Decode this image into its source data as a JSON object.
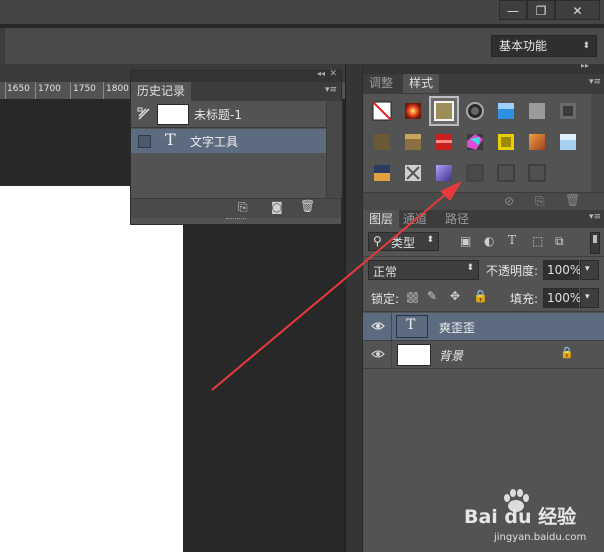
{
  "window": {
    "minimize": "—",
    "restore": "❐",
    "close": "✕"
  },
  "optionsbar": {
    "workspace": "基本功能"
  },
  "ruler": {
    "ticks": [
      "1650",
      "1700",
      "1750",
      "1800"
    ]
  },
  "history_panel": {
    "title": "历史记录",
    "snapshot_label": "未标题-1",
    "states": [
      {
        "label": "文字工具",
        "icon": "T"
      }
    ]
  },
  "styles_panel": {
    "tabs": [
      "调整",
      "样式"
    ],
    "active_tab": "样式"
  },
  "layers_panel": {
    "tabs": [
      "图层",
      "通道",
      "路径"
    ],
    "active_tab": "图层",
    "filter_kind": "类型",
    "blend_mode": "正常",
    "opacity_label": "不透明度:",
    "opacity_value": "100%",
    "lock_label": "锁定:",
    "fill_label": "填充:",
    "fill_value": "100%",
    "layers": [
      {
        "name": "爽歪歪",
        "type": "text",
        "selected": true
      },
      {
        "name": "背景",
        "type": "background",
        "locked": true,
        "selected": false
      }
    ]
  },
  "watermark": {
    "logo_text": "Bai du 经验",
    "url": "jingyan.baidu.com"
  },
  "colors": {
    "accent_selected_row": "#5c6b80",
    "arrow": "#e83a3a"
  }
}
